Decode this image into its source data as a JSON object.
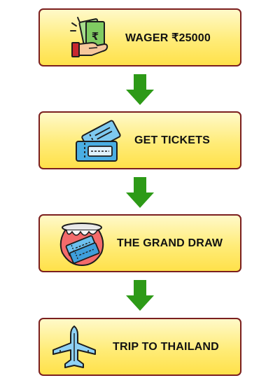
{
  "steps": [
    {
      "label": "WAGER ₹25000",
      "icon": "money-hand-icon"
    },
    {
      "label": "GET TICKETS",
      "icon": "tickets-icon"
    },
    {
      "label": "THE GRAND DRAW",
      "icon": "ticket-pot-icon"
    },
    {
      "label": "TRIP TO THAILAND",
      "icon": "airplane-icon"
    }
  ],
  "colors": {
    "box_border": "#7b1f1f",
    "box_fill_top": "#fff9c9",
    "box_fill_bottom": "#ffe14a",
    "arrow": "#2d9a17"
  }
}
